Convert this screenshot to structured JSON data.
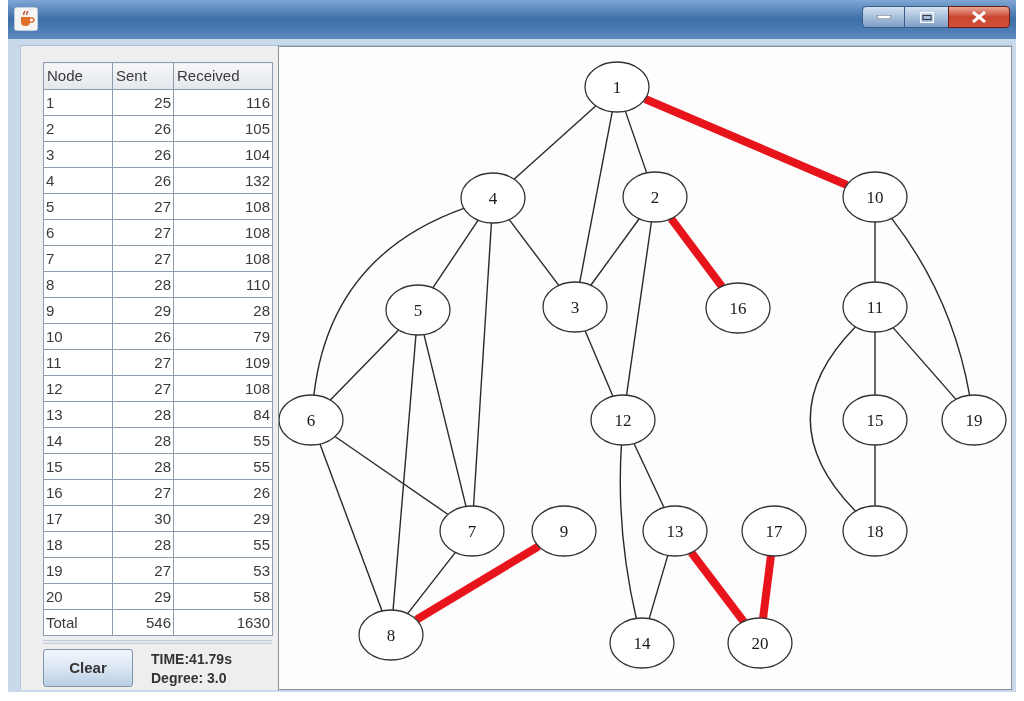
{
  "table": {
    "columns": [
      "Node",
      "Sent",
      "Received"
    ],
    "rows": [
      [
        "1",
        "25",
        "116"
      ],
      [
        "2",
        "26",
        "105"
      ],
      [
        "3",
        "26",
        "104"
      ],
      [
        "4",
        "26",
        "132"
      ],
      [
        "5",
        "27",
        "108"
      ],
      [
        "6",
        "27",
        "108"
      ],
      [
        "7",
        "27",
        "108"
      ],
      [
        "8",
        "28",
        "110"
      ],
      [
        "9",
        "29",
        "28"
      ],
      [
        "10",
        "26",
        "79"
      ],
      [
        "11",
        "27",
        "109"
      ],
      [
        "12",
        "27",
        "108"
      ],
      [
        "13",
        "28",
        "84"
      ],
      [
        "14",
        "28",
        "55"
      ],
      [
        "15",
        "28",
        "55"
      ],
      [
        "16",
        "27",
        "26"
      ],
      [
        "17",
        "30",
        "29"
      ],
      [
        "18",
        "28",
        "55"
      ],
      [
        "19",
        "27",
        "53"
      ],
      [
        "20",
        "29",
        "58"
      ],
      [
        "Total",
        "546",
        "1630"
      ]
    ]
  },
  "clear_button": "Clear",
  "stats": [
    "TIME:41.79s",
    "Degree: 3.0"
  ],
  "graph": {
    "nodes": [
      {
        "label": "1"
      },
      {
        "label": "2"
      },
      {
        "label": "3"
      },
      {
        "label": "4"
      },
      {
        "label": "5"
      },
      {
        "label": "6"
      },
      {
        "label": "7"
      },
      {
        "label": "8"
      },
      {
        "label": "9"
      },
      {
        "label": "10"
      },
      {
        "label": "11"
      },
      {
        "label": "12"
      },
      {
        "label": "13"
      },
      {
        "label": "14"
      },
      {
        "label": "15"
      },
      {
        "label": "16"
      },
      {
        "label": "17"
      },
      {
        "label": "18"
      },
      {
        "label": "19"
      },
      {
        "label": "20"
      }
    ],
    "edges": [
      {
        "highlighted": false
      },
      {
        "highlighted": false
      },
      {
        "highlighted": false
      },
      {
        "highlighted": true
      },
      {
        "highlighted": false
      },
      {
        "highlighted": false
      },
      {
        "highlighted": false
      },
      {
        "highlighted": false
      },
      {
        "highlighted": false
      },
      {
        "highlighted": false
      },
      {
        "highlighted": true
      },
      {
        "highlighted": false
      },
      {
        "highlighted": false
      },
      {
        "highlighted": false
      },
      {
        "highlighted": false
      },
      {
        "highlighted": false
      },
      {
        "highlighted": false
      },
      {
        "highlighted": false
      },
      {
        "highlighted": false
      },
      {
        "highlighted": false
      },
      {
        "highlighted": false
      },
      {
        "highlighted": false
      },
      {
        "highlighted": false
      },
      {
        "highlighted": false
      },
      {
        "highlighted": false
      },
      {
        "highlighted": false
      },
      {
        "highlighted": true
      },
      {
        "highlighted": false
      },
      {
        "highlighted": true
      },
      {
        "highlighted": true
      }
    ]
  }
}
